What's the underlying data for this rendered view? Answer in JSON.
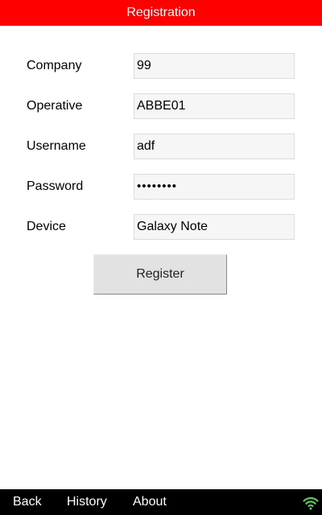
{
  "header": {
    "title": "Registration"
  },
  "form": {
    "fields": [
      {
        "label": "Company",
        "value": "99"
      },
      {
        "label": "Operative",
        "value": "ABBE01"
      },
      {
        "label": "Username",
        "value": "adf"
      },
      {
        "label": "Password",
        "value": "••••••••"
      },
      {
        "label": "Device",
        "value": "Galaxy Note"
      }
    ],
    "register_label": "Register"
  },
  "bottom_nav": {
    "back_label": "Back",
    "history_label": "History",
    "about_label": "About",
    "status_icon": "wifi-icon"
  },
  "colors": {
    "title_bar": "#ff0000",
    "bottom_bar": "#000000",
    "wifi_signal": "#5ac85a"
  }
}
